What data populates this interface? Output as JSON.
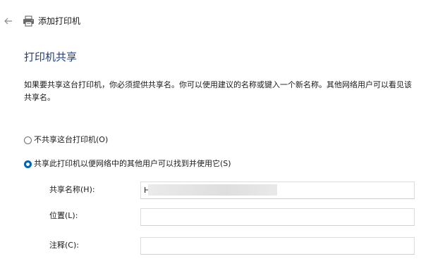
{
  "header": {
    "title": "添加打印机",
    "back_icon": "back-arrow-icon",
    "printer_icon": "printer-icon"
  },
  "main": {
    "heading": "打印机共享",
    "description": "如果要共享这台打印机，你必须提供共享名。你可以使用建议的名称或键入一个新名称。其他网络用户可以看见该共享名。",
    "options": [
      {
        "label": "不共享这台打印机(O)",
        "selected": false
      },
      {
        "label": "共享此打印机以便网络中的其他用户可以找到并使用它(S)",
        "selected": true
      }
    ],
    "fields": {
      "share_name_label": "共享名称(H):",
      "share_name_value": "H                                           6",
      "location_label": "位置(L):",
      "location_value": "",
      "comment_label": "注释(C):",
      "comment_value": ""
    }
  },
  "colors": {
    "heading": "#1f3d8a",
    "radio_selected": "#0063b1"
  }
}
